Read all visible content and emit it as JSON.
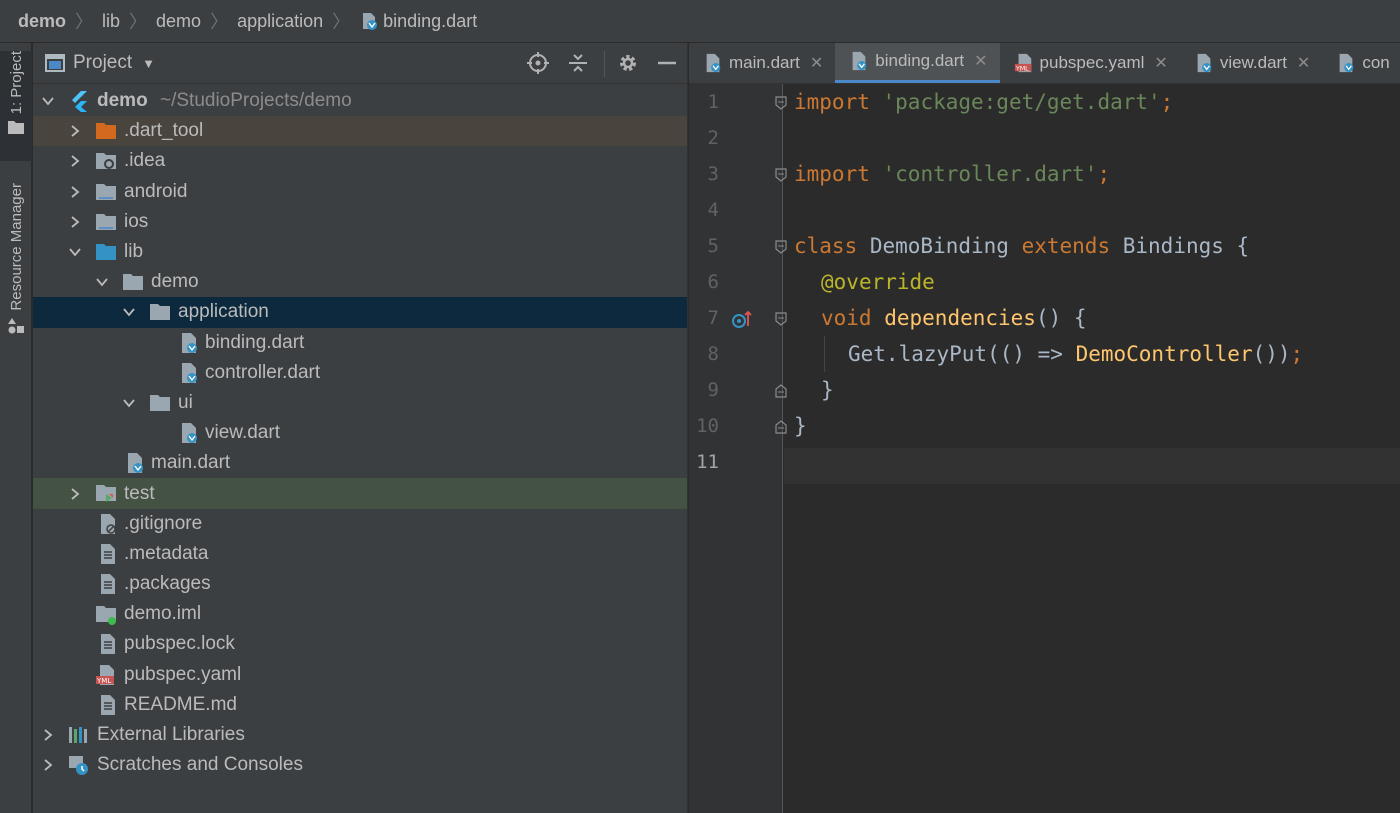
{
  "breadcrumb": {
    "items": [
      "demo",
      "lib",
      "demo",
      "application",
      "binding.dart"
    ]
  },
  "side_tabs": {
    "project": "1: Project",
    "resource_manager": "Resource Manager"
  },
  "project_panel": {
    "title": "Project",
    "tree": [
      {
        "label": "demo",
        "hint": "~/StudioProjects/demo"
      },
      {
        "label": ".dart_tool"
      },
      {
        "label": ".idea"
      },
      {
        "label": "android"
      },
      {
        "label": "ios"
      },
      {
        "label": "lib"
      },
      {
        "label": "demo"
      },
      {
        "label": "application"
      },
      {
        "label": "binding.dart"
      },
      {
        "label": "controller.dart"
      },
      {
        "label": "ui"
      },
      {
        "label": "view.dart"
      },
      {
        "label": "main.dart"
      },
      {
        "label": "test"
      },
      {
        "label": ".gitignore"
      },
      {
        "label": ".metadata"
      },
      {
        "label": ".packages"
      },
      {
        "label": "demo.iml"
      },
      {
        "label": "pubspec.lock"
      },
      {
        "label": "pubspec.yaml"
      },
      {
        "label": "README.md"
      },
      {
        "label": "External Libraries"
      },
      {
        "label": "Scratches and Consoles"
      }
    ]
  },
  "editor": {
    "tabs": [
      {
        "label": "main.dart"
      },
      {
        "label": "binding.dart"
      },
      {
        "label": "pubspec.yaml"
      },
      {
        "label": "view.dart"
      },
      {
        "label": "con"
      }
    ],
    "line_numbers": [
      "1",
      "2",
      "3",
      "4",
      "5",
      "6",
      "7",
      "8",
      "9",
      "10",
      "11"
    ],
    "code": {
      "l1_kw": "import",
      "l1_str": "'package:get/get.dart'",
      "l1_end": ";",
      "l3_kw": "import",
      "l3_str": "'controller.dart'",
      "l3_end": ";",
      "l5_kw1": "class",
      "l5_name": " DemoBinding ",
      "l5_kw2": "extends",
      "l5_rest": " Bindings {",
      "l6_at": "@",
      "l6_ann": "override",
      "l7_kw": "void",
      "l7_fn": "dependencies",
      "l7_rest": "() {",
      "l8_pre": "Get.lazyPut(() => ",
      "l8_fn": "DemoController",
      "l8_post": "())",
      "l8_end": ";",
      "l9": "}",
      "l10": "}"
    }
  },
  "colors": {
    "keyword": "#cc7832",
    "string": "#6a8759",
    "annotation": "#bbb529",
    "function": "#ffc66d",
    "selection": "#0d293e",
    "accent": "#4a88c7"
  }
}
